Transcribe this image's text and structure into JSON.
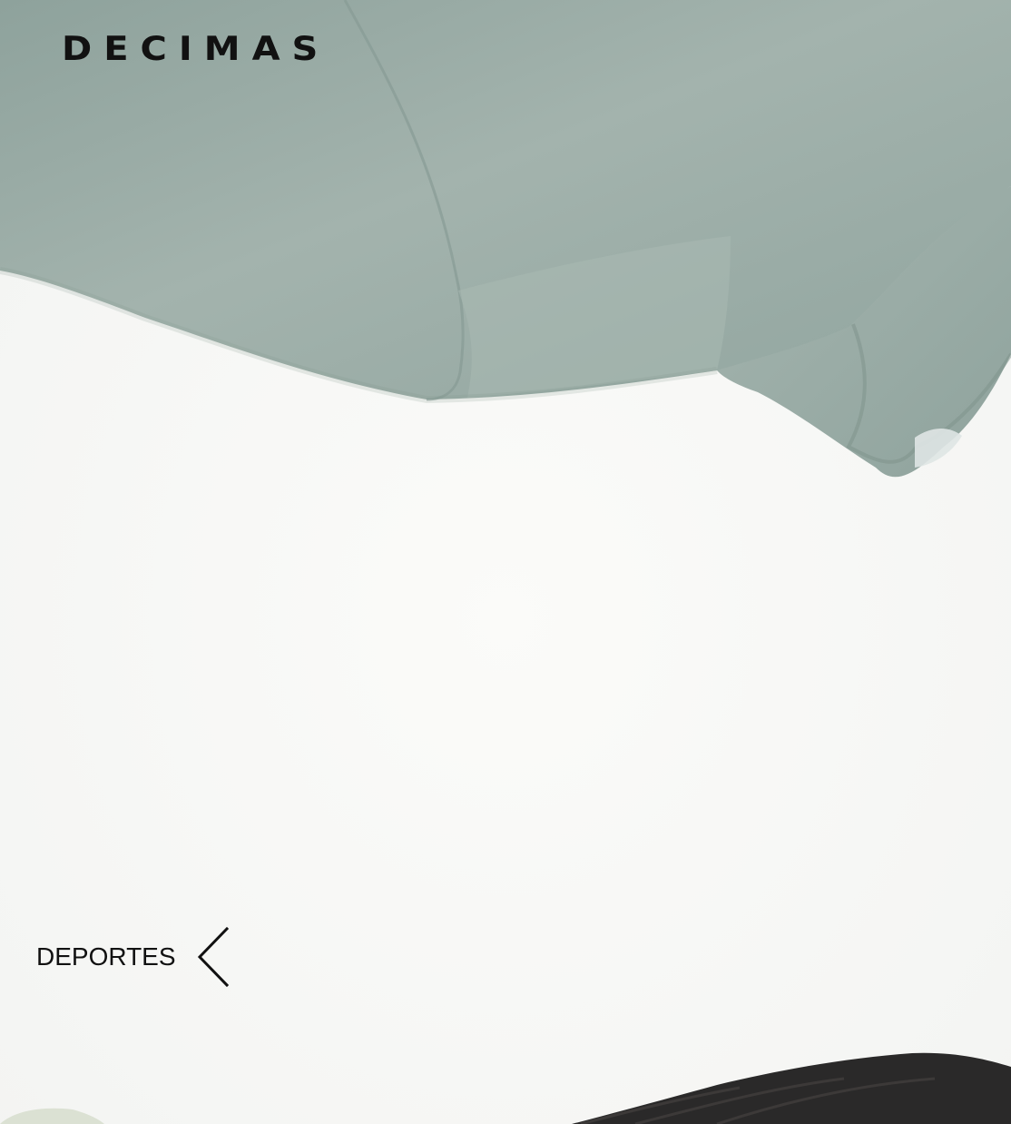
{
  "brand": {
    "logo_text": "DECIMAS"
  },
  "navigation": {
    "category_label": "DEPORTES",
    "arrow_icon": "chevron-left-icon"
  },
  "colors": {
    "background": "#f7f8f6",
    "garment": "#9aaba5",
    "garment_shadow": "#829690",
    "text": "#111111",
    "hair": "#2a2929"
  }
}
